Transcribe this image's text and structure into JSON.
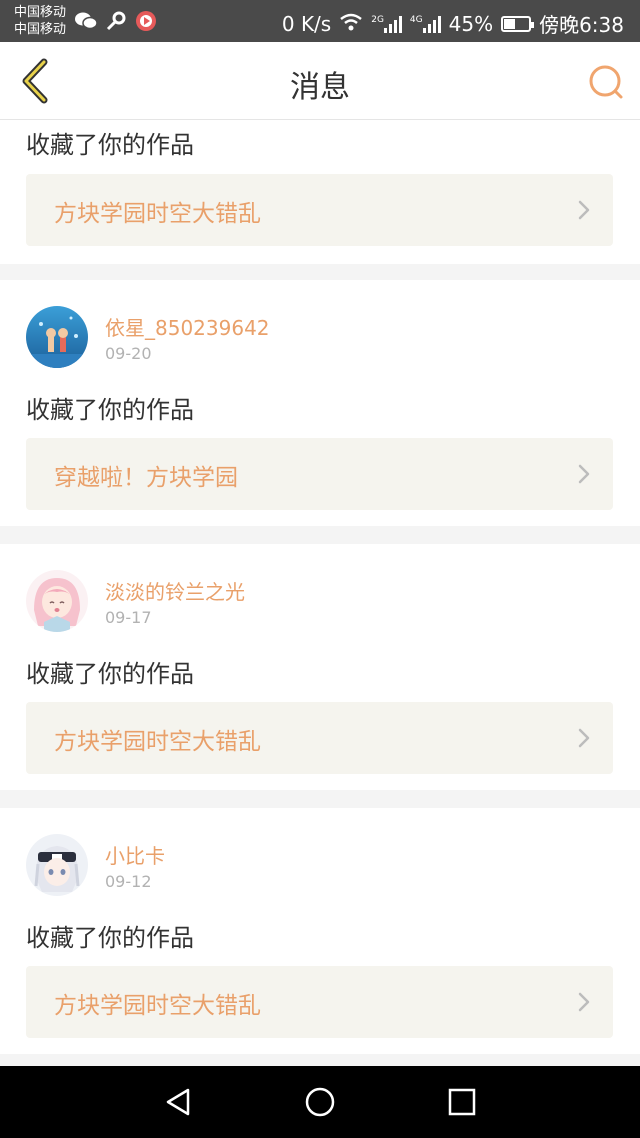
{
  "status_bar": {
    "carrier1": "中国移动",
    "carrier2": "中国移动",
    "net_speed": "0 K/s",
    "net_2g": "2G",
    "net_4g": "4G",
    "battery_percent": "45%",
    "battery_level": 0.45,
    "time": "傍晚6:38",
    "icons": [
      "wechat-icon",
      "key-icon",
      "record-icon",
      "wifi-icon",
      "signal-icon",
      "battery-icon"
    ]
  },
  "header": {
    "title": "消息",
    "back_icon": "chevron-left-icon",
    "search_icon": "search-icon",
    "accent_color": "#f0a56e"
  },
  "messages": [
    {
      "action": "收藏了你的作品",
      "work_title": "方块学园时空大错乱"
    },
    {
      "username": "依星_850239642",
      "date": "09-20",
      "action": "收藏了你的作品",
      "work_title": "穿越啦！方块学园"
    },
    {
      "username": "淡淡的铃兰之光",
      "date": "09-17",
      "action": "收藏了你的作品",
      "work_title": "方块学园时空大错乱"
    },
    {
      "username": "小比卡",
      "date": "09-12",
      "action": "收藏了你的作品",
      "work_title": "方块学园时空大错乱"
    }
  ],
  "colors": {
    "name_color": "#e9a06a",
    "work_bg": "#f5f4ee",
    "divider": "#f4f4f4"
  },
  "nav": {
    "icons": [
      "back-triangle-icon",
      "home-circle-icon",
      "recents-square-icon"
    ]
  }
}
